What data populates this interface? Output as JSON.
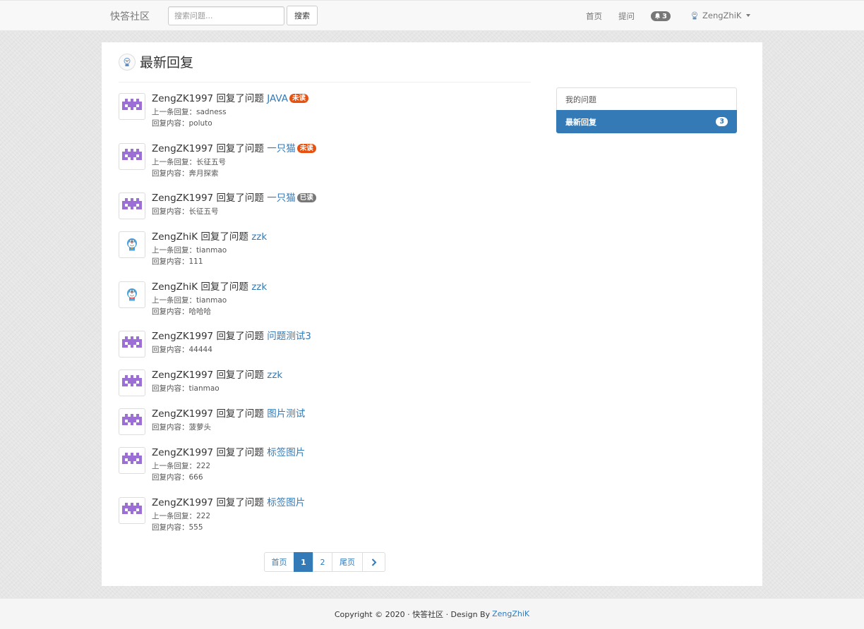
{
  "nav": {
    "brand": "快答社区",
    "search_placeholder": "搜索问题...",
    "search_button": "搜索",
    "home": "首页",
    "ask": "提问",
    "notify_count": "3",
    "username": "ZengZhiK"
  },
  "page": {
    "title": "最新回复"
  },
  "replies": [
    {
      "user": "ZengZK1997",
      "action": "回复了问题",
      "question": "JAVA",
      "badge": "未读",
      "badge_color": "#e8500f",
      "avatar": "pixel",
      "lines": [
        "上一条回复：sadness",
        "回复内容：poluto"
      ]
    },
    {
      "user": "ZengZK1997",
      "action": "回复了问题",
      "question": "一只猫",
      "badge": "未读",
      "badge_color": "#e8500f",
      "avatar": "pixel",
      "lines": [
        "上一条回复：长征五号",
        "回复内容：奔月探索"
      ]
    },
    {
      "user": "ZengZK1997",
      "action": "回复了问题",
      "question": "一只猫",
      "badge": "已读",
      "badge_color": "#777777",
      "avatar": "pixel",
      "lines": [
        "回复内容：长征五号"
      ]
    },
    {
      "user": "ZengZhiK",
      "action": "回复了问题",
      "question": "zzk",
      "badge": "",
      "badge_color": "",
      "avatar": "doraemon",
      "lines": [
        "上一条回复：tianmao",
        "回复内容：111"
      ]
    },
    {
      "user": "ZengZhiK",
      "action": "回复了问题",
      "question": "zzk",
      "badge": "",
      "badge_color": "",
      "avatar": "doraemon",
      "lines": [
        "上一条回复：tianmao",
        "回复内容：哈哈哈"
      ]
    },
    {
      "user": "ZengZK1997",
      "action": "回复了问题",
      "question": "问题测试3",
      "badge": "",
      "badge_color": "",
      "avatar": "pixel",
      "lines": [
        "回复内容：44444"
      ]
    },
    {
      "user": "ZengZK1997",
      "action": "回复了问题",
      "question": "zzk",
      "badge": "",
      "badge_color": "",
      "avatar": "pixel",
      "lines": [
        "回复内容：tianmao"
      ]
    },
    {
      "user": "ZengZK1997",
      "action": "回复了问题",
      "question": "图片测试",
      "badge": "",
      "badge_color": "",
      "avatar": "pixel",
      "lines": [
        "回复内容：菠萝头"
      ]
    },
    {
      "user": "ZengZK1997",
      "action": "回复了问题",
      "question": "标签图片",
      "badge": "",
      "badge_color": "",
      "avatar": "pixel",
      "lines": [
        "上一条回复：222",
        "回复内容：666"
      ]
    },
    {
      "user": "ZengZK1997",
      "action": "回复了问题",
      "question": "标签图片",
      "badge": "",
      "badge_color": "",
      "avatar": "pixel",
      "lines": [
        "上一条回复：222",
        "回复内容：555"
      ]
    }
  ],
  "pagination": {
    "first": "首页",
    "pages": [
      "1",
      "2"
    ],
    "current": "1",
    "last": "尾页",
    "next_icon": "chevron-right-icon"
  },
  "sidebar": {
    "items": [
      {
        "label": "我的问题",
        "count": ""
      },
      {
        "label": "最新回复",
        "count": "3"
      }
    ]
  },
  "footer": {
    "text": "Copyright © 2020 · 快答社区 · Design By",
    "author": "ZengZhiK"
  },
  "colors": {
    "primary": "#337ab7",
    "unread": "#e8500f",
    "read": "#777777",
    "avatar_pixel": "#9b6fd6"
  }
}
